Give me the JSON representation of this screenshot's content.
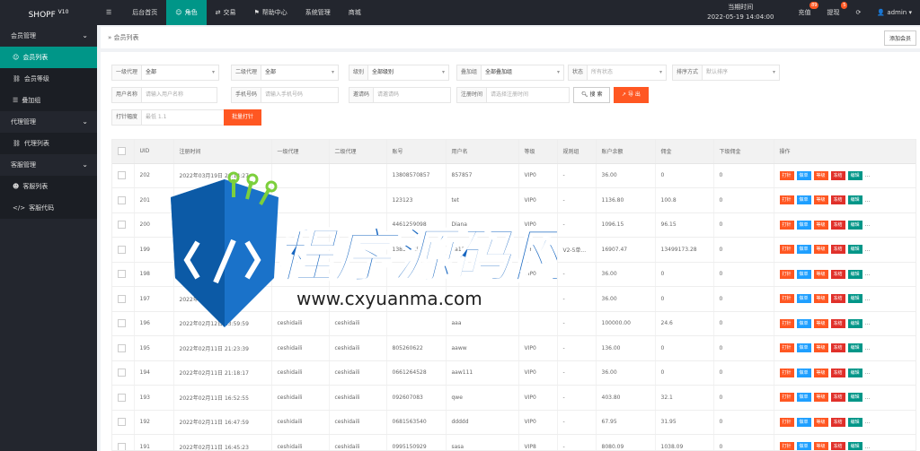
{
  "app": {
    "title": "SHOPF",
    "version": "V10"
  },
  "nav": [
    {
      "icon": "menu-icon",
      "label": ""
    },
    {
      "icon": "",
      "label": "后台首页"
    },
    {
      "icon": "person-icon",
      "label": "角色"
    },
    {
      "icon": "exchange-icon",
      "label": "交易"
    },
    {
      "icon": "flag-icon",
      "label": "帮助中心"
    },
    {
      "icon": "",
      "label": "系统管理"
    },
    {
      "icon": "",
      "label": "商城"
    }
  ],
  "topright": {
    "time_label": "当期时间",
    "time_value": "2022-05-19 14:04:00",
    "recharge_label": "充值",
    "recharge_badge": "89",
    "withdraw_label": "提现",
    "withdraw_badge": "5",
    "user": "admin"
  },
  "sidebar": [
    {
      "type": "group",
      "label": "会员管理"
    },
    {
      "type": "item",
      "label": "会员列表",
      "icon": "person-icon",
      "active": true
    },
    {
      "type": "item",
      "label": "会员等级",
      "icon": "link-icon"
    },
    {
      "type": "item",
      "label": "叠加组",
      "icon": "list-icon"
    },
    {
      "type": "group",
      "label": "代理管理"
    },
    {
      "type": "item",
      "label": "代理列表",
      "icon": "link-icon"
    },
    {
      "type": "group",
      "label": "客服管理"
    },
    {
      "type": "item",
      "label": "客服列表",
      "icon": "users-icon"
    },
    {
      "type": "item",
      "label": "客服代码",
      "icon": "code-icon"
    }
  ],
  "breadcrumb": "» 会员列表",
  "add_member": "添加会员",
  "filters": {
    "agent1_label": "一级代理",
    "agent1_value": "全部",
    "agent2_label": "二级代理",
    "agent2_value": "全部",
    "level_label": "级别",
    "level_value": "全部级别",
    "stack_label": "叠加组",
    "stack_value": "全部叠加组",
    "status_label": "状态",
    "status_placeholder": "所有状态",
    "sort_label": "排序方式",
    "sort_placeholder": "默认排序",
    "username_label": "用户名称",
    "username_placeholder": "请输入用户名称",
    "phone_label": "手机号码",
    "phone_placeholder": "请输入手机号码",
    "invite_label": "邀请码",
    "invite_placeholder": "请邀请码",
    "regtime_label": "注册时间",
    "regtime_placeholder": "请选择注册时间",
    "search_btn": "搜 索",
    "export_btn": "导 出",
    "inject_label": "打针幅度",
    "inject_placeholder": "最低 1.1",
    "batch_btn": "批量打针"
  },
  "table": {
    "headers": [
      "",
      "UID",
      "注册时间",
      "一级代理",
      "二级代理",
      "账号",
      "用户名",
      "等级",
      "规则组",
      "账户余额",
      "佣金",
      "下级佣金",
      "操作"
    ],
    "ops": [
      "打针",
      "做单",
      "等级",
      "冻结",
      "编辑",
      "..."
    ],
    "rows": [
      [
        "202",
        "2022年03月19日 20:14:27",
        "",
        "",
        "13808570857",
        "857857",
        "VIP0",
        "-",
        "36.00",
        "0",
        "0"
      ],
      [
        "201",
        "45",
        "",
        "",
        "123123",
        "tet",
        "VIP0",
        "-",
        "1136.80",
        "100.8",
        "0"
      ],
      [
        "200",
        "",
        "",
        "",
        "4461259098",
        "Diana",
        "VIP0",
        "-",
        "1096.15",
        "96.15",
        "0"
      ],
      [
        "199",
        "",
        "",
        "",
        "13856785678",
        "aa123456",
        "VIP2",
        "V2-5单...",
        "16907.47",
        "13499173.28",
        "0"
      ],
      [
        "198",
        ":12:16",
        "",
        "",
        "",
        "",
        "VIP0",
        "-",
        "36.00",
        "0",
        "0"
      ],
      [
        "197",
        "2022年02月20日 17:32:04",
        "",
        "",
        "",
        "",
        "",
        "-",
        "36.00",
        "0",
        "0"
      ],
      [
        "196",
        "2022年02月12日 13:59:59",
        "ceshidaili",
        "ceshidaili",
        "",
        "aaa",
        "",
        "-",
        "100000.00",
        "24.6",
        "0"
      ],
      [
        "195",
        "2022年02月11日 21:23:39",
        "ceshidaili",
        "ceshidaili",
        "805260622",
        "aaww",
        "VIP0",
        "-",
        "136.00",
        "0",
        "0"
      ],
      [
        "194",
        "2022年02月11日 21:18:17",
        "ceshidaili",
        "ceshidaili",
        "0661264528",
        "aaw111",
        "VIP0",
        "-",
        "36.00",
        "0",
        "0"
      ],
      [
        "193",
        "2022年02月11日 16:52:55",
        "ceshidaili",
        "ceshidaili",
        "092607083",
        "qwe",
        "VIP0",
        "-",
        "403.80",
        "32.1",
        "0"
      ],
      [
        "192",
        "2022年02月11日 16:47:59",
        "ceshidaili",
        "ceshidaili",
        "0681563540",
        "ddddd",
        "VIP0",
        "-",
        "67.95",
        "31.95",
        "0"
      ],
      [
        "191",
        "2022年02月11日 16:45:23",
        "ceshidaili",
        "ceshidaili",
        "0995150929",
        "sasa",
        "VIP8",
        "-",
        "8080.09",
        "1038.09",
        "0"
      ]
    ]
  },
  "watermark": {
    "title": "程序源码网",
    "url": "www.cxyuanma.com"
  }
}
